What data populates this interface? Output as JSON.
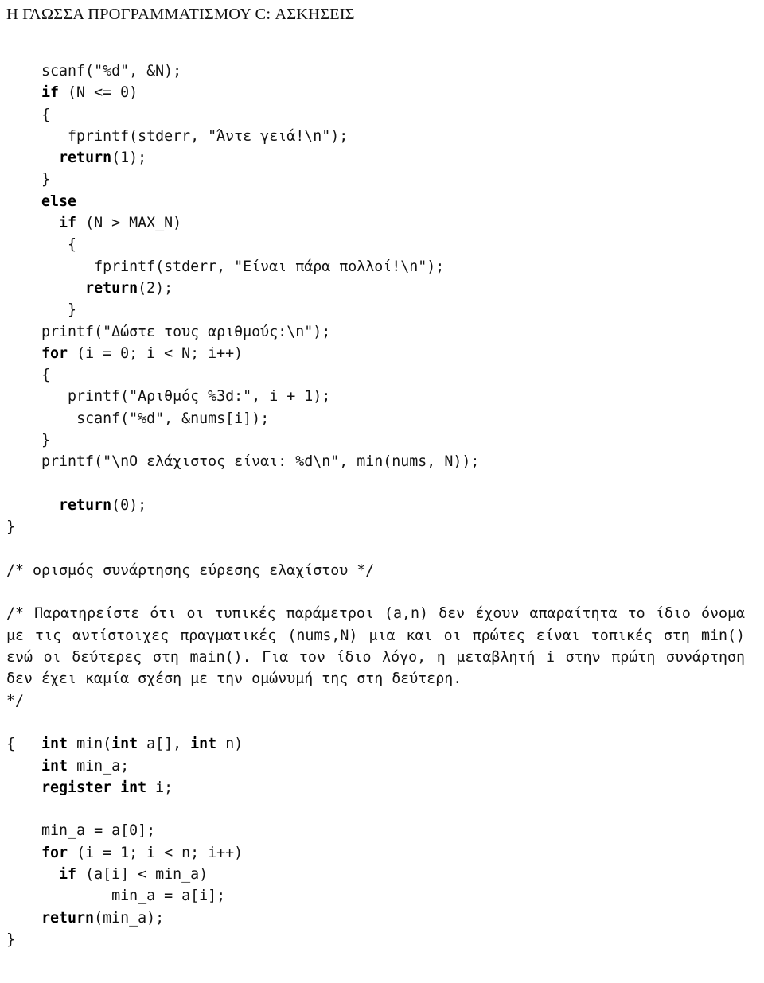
{
  "header": {
    "title": "Η ΓΛΩΣΣΑ ΠΡΟΓΡΑΜΜΑΤΙΣΜΟΥ C: ΑΣΚΗΣΕΙΣ"
  },
  "code_block_1": {
    "lines": [
      {
        "indent": "    ",
        "plain_before": "scanf(\"%d\", &N);",
        "keyword": "",
        "plain_after": ""
      },
      {
        "indent": "    ",
        "plain_before": "",
        "keyword": "if",
        "plain_after": " (N <= 0)"
      },
      {
        "indent": "    ",
        "plain_before": "{",
        "keyword": "",
        "plain_after": ""
      },
      {
        "indent": "       ",
        "plain_before": "fprintf(stderr, \"Άντε γειά!\\n\");",
        "keyword": "",
        "plain_after": ""
      },
      {
        "indent": "      ",
        "plain_before": "",
        "keyword": "return",
        "plain_after": "(1);"
      },
      {
        "indent": "    ",
        "plain_before": "}",
        "keyword": "",
        "plain_after": ""
      },
      {
        "indent": "    ",
        "plain_before": "",
        "keyword": "else",
        "plain_after": ""
      },
      {
        "indent": "      ",
        "plain_before": "",
        "keyword": "if",
        "plain_after": " (N > MAX_N)"
      },
      {
        "indent": "       ",
        "plain_before": "{",
        "keyword": "",
        "plain_after": ""
      },
      {
        "indent": "          ",
        "plain_before": "fprintf(stderr, \"Είναι πάρα πολλοί!\\n\");",
        "keyword": "",
        "plain_after": ""
      },
      {
        "indent": "         ",
        "plain_before": "",
        "keyword": "return",
        "plain_after": "(2);"
      },
      {
        "indent": "       ",
        "plain_before": "}",
        "keyword": "",
        "plain_after": ""
      },
      {
        "indent": "    ",
        "plain_before": "printf(\"Δώστε τους αριθμούς:\\n\");",
        "keyword": "",
        "plain_after": ""
      },
      {
        "indent": "    ",
        "plain_before": "",
        "keyword": "for",
        "plain_after": " (i = 0; i < N; i++)"
      },
      {
        "indent": "    ",
        "plain_before": "{",
        "keyword": "",
        "plain_after": ""
      },
      {
        "indent": "       ",
        "plain_before": "printf(\"Αριθμός %3d:\", i + 1);",
        "keyword": "",
        "plain_after": ""
      },
      {
        "indent": "        ",
        "plain_before": "scanf(\"%d\", &nums[i]);",
        "keyword": "",
        "plain_after": ""
      },
      {
        "indent": "    ",
        "plain_before": "}",
        "keyword": "",
        "plain_after": ""
      },
      {
        "indent": "    ",
        "plain_before": "printf(\"\\nΟ ελάχιστος είναι: %d\\n\", min(nums, N));",
        "keyword": "",
        "plain_after": ""
      },
      {
        "indent": "",
        "plain_before": "",
        "keyword": "",
        "plain_after": ""
      },
      {
        "indent": "      ",
        "plain_before": "",
        "keyword": "return",
        "plain_after": "(0);"
      },
      {
        "indent": "",
        "plain_before": "}",
        "keyword": "",
        "plain_after": ""
      }
    ]
  },
  "comments": {
    "function_def_comment": "/* ορισμός συνάρτησης εύρεσης ελαχίστου */",
    "observation_paragraph": "/* Παρατηρείστε ότι οι τυπικές παράμετροι (a,n) δεν έχουν απαραίτητα το ίδιο όνομα με τις αντίστοιχες πραγματικές (nums,N) μια και οι πρώτες είναι τοπικές στη min() ενώ οι δεύτερες στη main(). Για τον ίδιο λόγο, η μεταβλητή i στην πρώτη συνάρτηση δεν έχει καμία σχέση με την ομώνυμή της στη δεύτερη.",
    "comment_close": "*/"
  },
  "code_block_2": {
    "signature": {
      "kw1": "int",
      "mid1": " min(",
      "kw2": "int",
      "mid2": " a[], ",
      "kw3": "int",
      "mid3": " n)"
    },
    "lines": [
      {
        "indent": "",
        "plain_before": "{",
        "keyword": "",
        "plain_after": ""
      },
      {
        "indent": "    ",
        "plain_before": "",
        "keyword": "int",
        "plain_after": " min_a;"
      },
      {
        "indent": "    ",
        "plain_before": "",
        "keyword": "register int",
        "plain_after": " i;"
      },
      {
        "indent": "",
        "plain_before": "",
        "keyword": "",
        "plain_after": ""
      },
      {
        "indent": "    ",
        "plain_before": "min_a = a[0];",
        "keyword": "",
        "plain_after": ""
      },
      {
        "indent": "    ",
        "plain_before": "",
        "keyword": "for",
        "plain_after": " (i = 1; i < n; i++)"
      },
      {
        "indent": "      ",
        "plain_before": "",
        "keyword": "if",
        "plain_after": " (a[i] < min_a)"
      },
      {
        "indent": "            ",
        "plain_before": "min_a = a[i];",
        "keyword": "",
        "plain_after": ""
      },
      {
        "indent": "    ",
        "plain_before": "",
        "keyword": "return",
        "plain_after": "(min_a);"
      },
      {
        "indent": "",
        "plain_before": "}",
        "keyword": "",
        "plain_after": ""
      }
    ]
  },
  "colors": {
    "text": "#131313",
    "keyword": "#000000",
    "background": "#ffffff"
  }
}
